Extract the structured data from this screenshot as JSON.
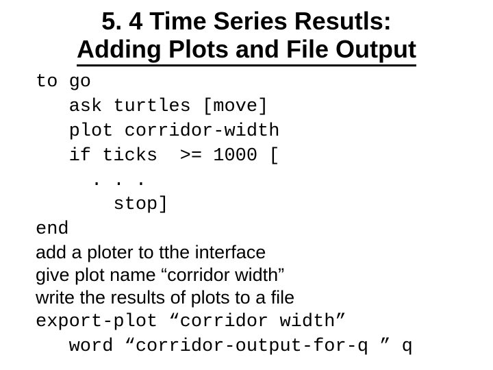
{
  "title_line1": "5. 4 Time Series Resutls:",
  "title_line2": "Adding Plots and  File Output",
  "code": {
    "l1": "to go",
    "l2": "   ask turtles [move]",
    "l3": "   plot corridor-width",
    "l4": "   if ticks  >= 1000 [",
    "l5": "     . . .",
    "l6": "       stop]",
    "l7": "end"
  },
  "notes": {
    "n1": "add a ploter to tthe interface",
    "n2": "give plot name “corridor width”",
    "n3": "write the results of plots to a file"
  },
  "code2": {
    "c1": "export-plot “corridor width”",
    "c2": "   word “corridor-output-for-q ” q"
  }
}
